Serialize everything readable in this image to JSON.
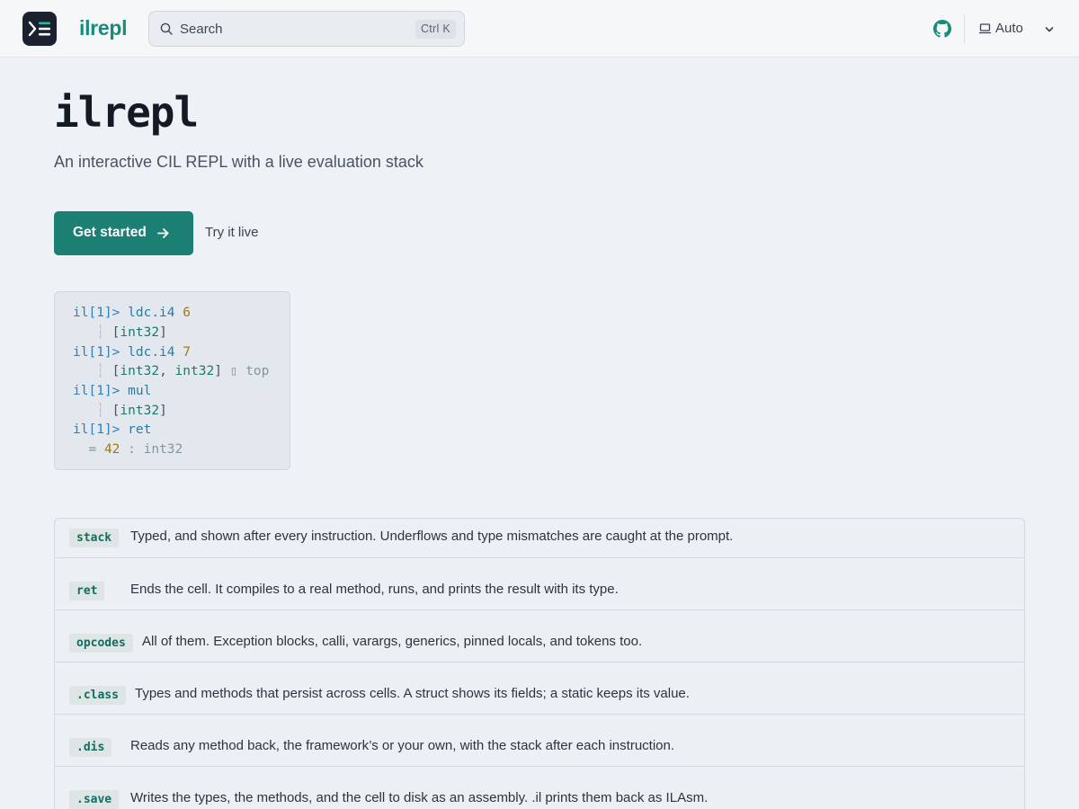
{
  "header": {
    "brand": "ilrepl",
    "search": {
      "placeholder": "Search",
      "shortcut": "Ctrl K"
    },
    "theme": {
      "label": "Auto"
    }
  },
  "hero": {
    "title": "ilrepl",
    "subtitle": "An interactive CIL REPL with a live evaluation stack",
    "cta_primary": "Get started",
    "cta_secondary": "Try it live"
  },
  "code": {
    "lines": [
      {
        "prompt": "il[1]>",
        "op": "ldc.i4",
        "arg": "6"
      },
      {
        "stack": [
          "int32"
        ]
      },
      {
        "prompt": "il[1]>",
        "op": "ldc.i4",
        "arg": "7"
      },
      {
        "stack": [
          "int32",
          "int32"
        ],
        "glyph": "▯",
        "note": "top"
      },
      {
        "prompt": "il[1]>",
        "op": "mul"
      },
      {
        "stack": [
          "int32"
        ]
      },
      {
        "prompt": "il[1]>",
        "op": "ret"
      },
      {
        "result": "42",
        "type": "int32"
      }
    ]
  },
  "features": [
    {
      "tag": "stack",
      "desc": "Typed, and shown after every instruction. Underflows and type mismatches are caught at the prompt."
    },
    {
      "tag": "ret",
      "desc": "Ends the cell. It compiles to a real method, runs, and prints the result with its type."
    },
    {
      "tag": "opcodes",
      "desc": "All of them. Exception blocks, calli, varargs, generics, pinned locals, and tokens too."
    },
    {
      "tag": ".class",
      "desc": "Types and methods that persist across cells. A struct shows its fields; a static keeps its value."
    },
    {
      "tag": ".dis",
      "desc": "Reads any method back, the framework’s or your own, with the stack after each instruction."
    },
    {
      "tag": ".save",
      "desc": "Writes the types, the methods, and the cell to disk as an assembly. .il prints them back as ILAsm."
    }
  ],
  "colors": {
    "accent": "#1b7f74",
    "brand": "#1a8a7c",
    "background": "#eef1f5"
  },
  "icons": [
    "app-logo-icon",
    "search-icon",
    "github-icon",
    "monitor-icon",
    "chevron-down-icon",
    "arrow-right-icon"
  ]
}
